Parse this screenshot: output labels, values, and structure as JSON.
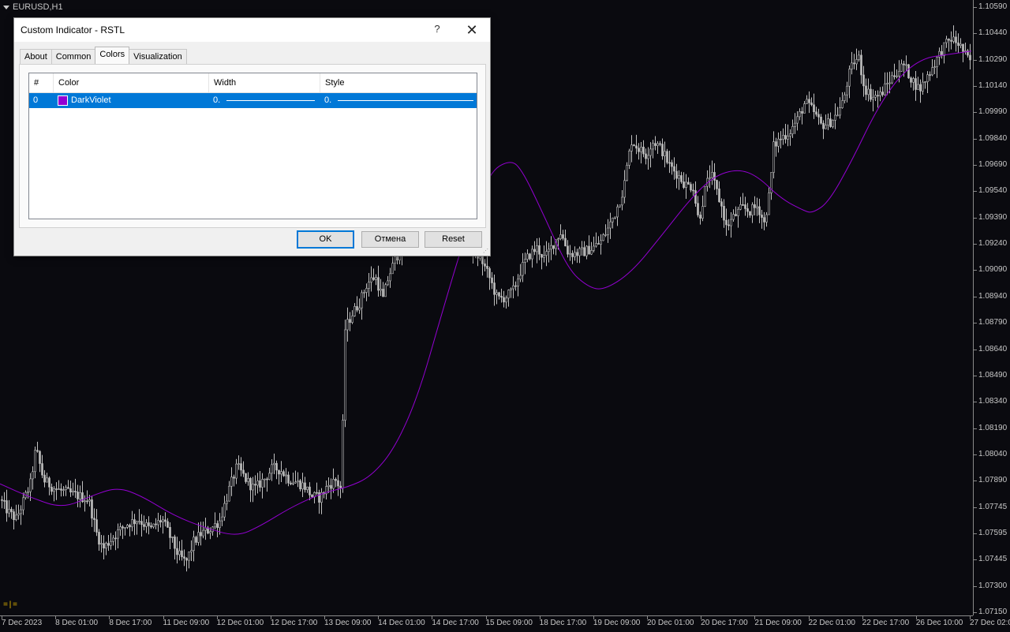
{
  "chart": {
    "symbol": "EURUSD,H1",
    "corner_mark": "=|=",
    "background": "#0a0a0f",
    "candle_color": "#c0c0c0",
    "indicator_color": "#9400d3",
    "price_labels": [
      "1.10590",
      "1.10440",
      "1.10290",
      "1.10140",
      "1.09990",
      "1.09840",
      "1.09690",
      "1.09540",
      "1.09390",
      "1.09240",
      "1.09090",
      "1.08940",
      "1.08790",
      "1.08640",
      "1.08490",
      "1.08340",
      "1.08190",
      "1.08040",
      "1.07890",
      "1.07745",
      "1.07595",
      "1.07445",
      "1.07300",
      "1.07150"
    ],
    "time_labels": [
      "7 Dec 2023",
      "8 Dec 01:00",
      "8 Dec 17:00",
      "11 Dec 09:00",
      "12 Dec 01:00",
      "12 Dec 17:00",
      "13 Dec 09:00",
      "14 Dec 01:00",
      "14 Dec 17:00",
      "15 Dec 09:00",
      "18 Dec 17:00",
      "19 Dec 09:00",
      "20 Dec 01:00",
      "20 Dec 17:00",
      "21 Dec 09:00",
      "22 Dec 01:00",
      "22 Dec 17:00",
      "26 Dec 10:00",
      "27 Dec 02:00"
    ]
  },
  "chart_data": {
    "type": "candlestick",
    "symbol": "EURUSD",
    "timeframe": "H1",
    "ylim": [
      1.0715,
      1.1059
    ],
    "close_path": [
      [
        0,
        1.0779
      ],
      [
        10,
        1.0772
      ],
      [
        20,
        1.0768
      ],
      [
        30,
        1.0779
      ],
      [
        38,
        1.0788
      ],
      [
        45,
        1.0808
      ],
      [
        55,
        1.079
      ],
      [
        70,
        1.0785
      ],
      [
        85,
        1.0783
      ],
      [
        100,
        1.0781
      ],
      [
        112,
        1.0779
      ],
      [
        122,
        1.076
      ],
      [
        130,
        1.0751
      ],
      [
        145,
        1.0759
      ],
      [
        160,
        1.0765
      ],
      [
        175,
        1.0768
      ],
      [
        190,
        1.0762
      ],
      [
        205,
        1.0768
      ],
      [
        215,
        1.0758
      ],
      [
        225,
        1.0748
      ],
      [
        235,
        1.0743
      ],
      [
        245,
        1.0755
      ],
      [
        255,
        1.076
      ],
      [
        265,
        1.0762
      ],
      [
        278,
        1.0767
      ],
      [
        290,
        1.0785
      ],
      [
        300,
        1.0798
      ],
      [
        312,
        1.079
      ],
      [
        322,
        1.0785
      ],
      [
        335,
        1.0791
      ],
      [
        345,
        1.0797
      ],
      [
        355,
        1.0796
      ],
      [
        365,
        1.0791
      ],
      [
        375,
        1.0789
      ],
      [
        385,
        1.0787
      ],
      [
        395,
        1.0781
      ],
      [
        405,
        1.078
      ],
      [
        415,
        1.0787
      ],
      [
        425,
        1.079
      ],
      [
        432,
        1.0785
      ],
      [
        437,
        1.0876
      ],
      [
        445,
        1.0884
      ],
      [
        455,
        1.0891
      ],
      [
        465,
        1.0902
      ],
      [
        475,
        1.0906
      ],
      [
        485,
        1.0893
      ],
      [
        492,
        1.0906
      ],
      [
        500,
        1.0915
      ],
      [
        510,
        1.0925
      ],
      [
        520,
        1.0938
      ],
      [
        530,
        1.0951
      ],
      [
        540,
        1.0962
      ],
      [
        550,
        1.0966
      ],
      [
        560,
        1.0955
      ],
      [
        575,
        1.0945
      ],
      [
        585,
        1.0935
      ],
      [
        600,
        1.092
      ],
      [
        610,
        1.0915
      ],
      [
        620,
        1.0905
      ],
      [
        630,
        1.0893
      ],
      [
        640,
        1.0894
      ],
      [
        650,
        1.0898
      ],
      [
        660,
        1.091
      ],
      [
        670,
        1.0918
      ],
      [
        680,
        1.0922
      ],
      [
        690,
        1.0916
      ],
      [
        700,
        1.0924
      ],
      [
        710,
        1.0931
      ],
      [
        720,
        1.0919
      ],
      [
        730,
        1.0919
      ],
      [
        740,
        1.092
      ],
      [
        750,
        1.0922
      ],
      [
        760,
        1.0925
      ],
      [
        770,
        1.0933
      ],
      [
        780,
        1.0943
      ],
      [
        790,
        1.0956
      ],
      [
        795,
        1.0971
      ],
      [
        800,
        1.0983
      ],
      [
        808,
        1.0979
      ],
      [
        818,
        1.0975
      ],
      [
        828,
        1.0983
      ],
      [
        838,
        1.0978
      ],
      [
        848,
        1.0969
      ],
      [
        858,
        1.0964
      ],
      [
        868,
        1.0958
      ],
      [
        878,
        1.0957
      ],
      [
        885,
        1.0937
      ],
      [
        893,
        1.0955
      ],
      [
        900,
        1.0965
      ],
      [
        908,
        1.0954
      ],
      [
        915,
        1.0944
      ],
      [
        920,
        1.0934
      ],
      [
        930,
        1.094
      ],
      [
        940,
        1.0945
      ],
      [
        950,
        1.0943
      ],
      [
        960,
        1.0946
      ],
      [
        968,
        1.0936
      ],
      [
        975,
        1.0954
      ],
      [
        980,
        1.098
      ],
      [
        990,
        1.0985
      ],
      [
        1000,
        1.0988
      ],
      [
        1010,
        1.0995
      ],
      [
        1020,
        1.1005
      ],
      [
        1030,
        1.1
      ],
      [
        1040,
        1.0992
      ],
      [
        1050,
        1.0993
      ],
      [
        1060,
        1.0998
      ],
      [
        1068,
        1.1005
      ],
      [
        1075,
        1.102
      ],
      [
        1082,
        1.1028
      ],
      [
        1088,
        1.103
      ],
      [
        1095,
        1.1013
      ],
      [
        1105,
        1.1008
      ],
      [
        1115,
        1.1009
      ],
      [
        1125,
        1.1016
      ],
      [
        1135,
        1.1022
      ],
      [
        1145,
        1.1026
      ],
      [
        1155,
        1.1018
      ],
      [
        1165,
        1.1012
      ],
      [
        1175,
        1.102
      ],
      [
        1185,
        1.1028
      ],
      [
        1195,
        1.1036
      ],
      [
        1205,
        1.1041
      ],
      [
        1215,
        1.1038
      ],
      [
        1225,
        1.103
      ],
      [
        1231,
        1.1028
      ]
    ],
    "indicator_path": [
      [
        0,
        1.0788
      ],
      [
        40,
        1.078
      ],
      [
        80,
        1.0774
      ],
      [
        120,
        1.0782
      ],
      [
        150,
        1.0786
      ],
      [
        180,
        1.0781
      ],
      [
        220,
        1.077
      ],
      [
        260,
        1.0763
      ],
      [
        300,
        1.0758
      ],
      [
        330,
        1.0764
      ],
      [
        370,
        1.0775
      ],
      [
        410,
        1.0783
      ],
      [
        440,
        1.0786
      ],
      [
        470,
        1.0792
      ],
      [
        500,
        1.0808
      ],
      [
        530,
        1.0838
      ],
      [
        560,
        1.0885
      ],
      [
        590,
        1.093
      ],
      [
        620,
        1.0965
      ],
      [
        645,
        1.0972
      ],
      [
        660,
        1.0968
      ],
      [
        690,
        1.094
      ],
      [
        720,
        1.091
      ],
      [
        745,
        1.09
      ],
      [
        765,
        1.0898
      ],
      [
        800,
        1.0908
      ],
      [
        840,
        1.093
      ],
      [
        875,
        1.095
      ],
      [
        905,
        1.0963
      ],
      [
        935,
        1.0967
      ],
      [
        960,
        1.0963
      ],
      [
        990,
        1.095
      ],
      [
        1020,
        1.0943
      ],
      [
        1030,
        1.0942
      ],
      [
        1050,
        1.0948
      ],
      [
        1080,
        1.0972
      ],
      [
        1110,
        1.1
      ],
      [
        1140,
        1.102
      ],
      [
        1170,
        1.103
      ],
      [
        1200,
        1.1032
      ],
      [
        1231,
        1.1034
      ]
    ]
  },
  "dialog": {
    "title": "Custom Indicator - RSTL",
    "help": "?",
    "close": "✕",
    "tabs": [
      "About",
      "Common",
      "Colors",
      "Visualization"
    ],
    "active_tab": "Colors",
    "grid": {
      "headers": [
        "#",
        "Color",
        "Width",
        "Style"
      ],
      "rows": [
        {
          "index": "0",
          "color_name": "DarkViolet",
          "swatch": "#9400d3",
          "width": "0.",
          "style": "0."
        }
      ]
    },
    "buttons": {
      "ok": "OK",
      "cancel": "Отмена",
      "reset": "Reset"
    },
    "accent": "#0078d7"
  }
}
